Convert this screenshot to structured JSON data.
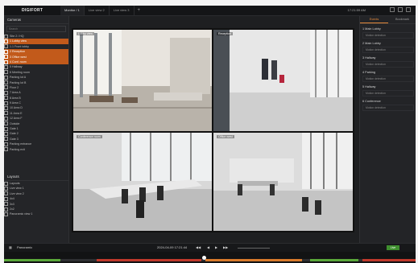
{
  "app": {
    "brand": "DIGIFORT"
  },
  "tabs": [
    {
      "label": "Monitor / 1"
    },
    {
      "label": "Live view 2"
    },
    {
      "label": "Live view 3"
    }
  ],
  "topinfo": "17:21:59 AM",
  "left_panel": {
    "title": "Cameras",
    "search_placeholder": "Search",
    "tree": [
      {
        "label": "Site 2 / HQ",
        "selected": false
      },
      {
        "label": "1 Lobby view",
        "selected": true
      },
      {
        "label": "1.1 Front lobby",
        "selected": false
      },
      {
        "label": "2 Reception",
        "selected": true
      },
      {
        "label": "3 Office west",
        "selected": true
      },
      {
        "label": "4 Conf. room",
        "selected": true
      },
      {
        "label": "5 Hallway",
        "selected": false
      },
      {
        "label": "6 Meeting room",
        "selected": false
      },
      {
        "label": "Parking lot A",
        "selected": false
      },
      {
        "label": "Parking lot B",
        "selected": false
      },
      {
        "label": "Floor 2",
        "selected": false
      },
      {
        "label": "7 Area A",
        "selected": false
      },
      {
        "label": "8 Area B",
        "selected": false
      },
      {
        "label": "9 Area C",
        "selected": false
      },
      {
        "label": "10 Area D",
        "selected": false
      },
      {
        "label": "11 Area E",
        "selected": false
      },
      {
        "label": "12 Area F",
        "selected": false
      },
      {
        "label": "Outside",
        "selected": false
      },
      {
        "label": "Gate 1",
        "selected": false
      },
      {
        "label": "Gate 2",
        "selected": false
      },
      {
        "label": "Gate 3",
        "selected": false
      },
      {
        "label": "Parking entrance",
        "selected": false
      },
      {
        "label": "Parking exit",
        "selected": false
      }
    ],
    "lower_title": "Layouts",
    "lower_tree": [
      {
        "label": "Layouts"
      },
      {
        "label": "Live view 1"
      },
      {
        "label": "Live view 2"
      },
      {
        "label": "4x4"
      },
      {
        "label": "3x3"
      },
      {
        "label": "2x2"
      },
      {
        "label": "Panoramic view 1"
      }
    ]
  },
  "video_tiles": [
    {
      "label": "Lobby view"
    },
    {
      "label": "Reception"
    },
    {
      "label": "Conference room"
    },
    {
      "label": "Office west"
    }
  ],
  "right_panel": {
    "tabs": [
      "Events",
      "Bookmark"
    ],
    "sections": [
      {
        "title": "1 Main Lobby",
        "row": "Motion detection"
      },
      {
        "title": "2 Main Lobby",
        "row": "Motion detection"
      },
      {
        "title": "3 Hallway",
        "row": "Motion detection"
      },
      {
        "title": "4 Parking",
        "row": "Motion detection"
      },
      {
        "title": "5 Hallway",
        "row": "Motion detection"
      },
      {
        "title": "6 Conference",
        "row": "Motion detection"
      }
    ]
  },
  "playback": {
    "layout_label": "Panoramic",
    "datetime": "2024-04-09 17:21:44",
    "live_label": "Live"
  },
  "timeline_segments_colors": {
    "green": "#5aa83a",
    "red": "#c0392b",
    "orange": "#d97a2b"
  }
}
